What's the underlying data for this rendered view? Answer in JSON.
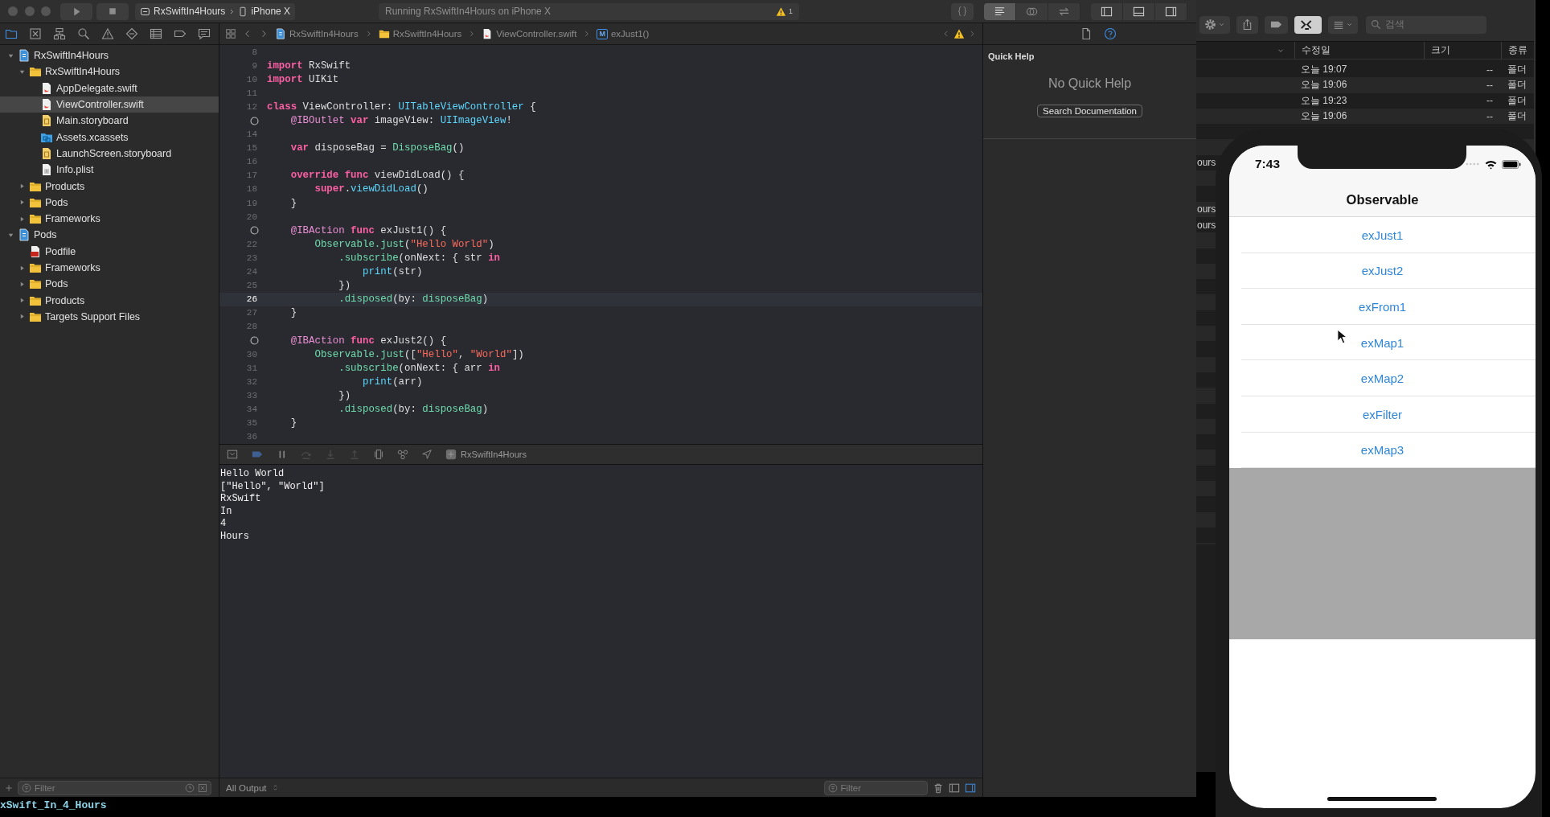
{
  "xcode": {
    "toolbar": {
      "scheme": "RxSwiftIn4Hours",
      "device": "iPhone X",
      "activity": "Running RxSwiftIn4Hours on iPhone X",
      "warning_count": "1"
    },
    "editor_modes": [
      {
        "kind": "standard",
        "selected": true
      },
      {
        "kind": "assistant",
        "selected": false
      },
      {
        "kind": "version",
        "selected": false
      }
    ],
    "panels": [
      {
        "kind": "navigator",
        "on": true
      },
      {
        "kind": "debug",
        "on": true
      },
      {
        "kind": "inspector",
        "on": true
      }
    ],
    "navigator_tabs": [
      {
        "kind": "project",
        "selected": true
      },
      {
        "kind": "source",
        "selected": false
      },
      {
        "kind": "symbol",
        "selected": false
      },
      {
        "kind": "find",
        "selected": false
      },
      {
        "kind": "issue",
        "selected": false
      },
      {
        "kind": "test",
        "selected": false
      },
      {
        "kind": "debug",
        "selected": false
      },
      {
        "kind": "breakpoint",
        "selected": false
      },
      {
        "kind": "report",
        "selected": false
      }
    ],
    "navigator": [
      {
        "name": "RxSwiftIn4Hours",
        "kind": "project",
        "expanded": true,
        "selected": false,
        "children": [
          {
            "name": "RxSwiftIn4Hours",
            "kind": "folder",
            "expanded": true,
            "selected": false,
            "children": [
              {
                "name": "AppDelegate.swift",
                "kind": "swift",
                "selected": false
              },
              {
                "name": "ViewController.swift",
                "kind": "swift",
                "selected": true
              },
              {
                "name": "Main.storyboard",
                "kind": "storyboard",
                "selected": false
              },
              {
                "name": "Assets.xcassets",
                "kind": "assets",
                "selected": false
              },
              {
                "name": "LaunchScreen.storyboard",
                "kind": "storyboard",
                "selected": false
              },
              {
                "name": "Info.plist",
                "kind": "plist",
                "selected": false
              }
            ]
          },
          {
            "name": "Products",
            "kind": "folder",
            "expanded": false,
            "selected": false
          },
          {
            "name": "Pods",
            "kind": "folder",
            "expanded": false,
            "selected": false
          },
          {
            "name": "Frameworks",
            "kind": "folder",
            "expanded": false,
            "selected": false
          }
        ]
      },
      {
        "name": "Pods",
        "kind": "project",
        "expanded": true,
        "selected": false,
        "children": [
          {
            "name": "Podfile",
            "kind": "ruby",
            "selected": false
          },
          {
            "name": "Frameworks",
            "kind": "folder",
            "expanded": false,
            "selected": false
          },
          {
            "name": "Pods",
            "kind": "folder",
            "expanded": false,
            "selected": false
          },
          {
            "name": "Products",
            "kind": "folder",
            "expanded": false,
            "selected": false
          },
          {
            "name": "Targets Support Files",
            "kind": "folder",
            "expanded": false,
            "selected": false
          }
        ]
      }
    ],
    "navigator_filter": {
      "placeholder": "Filter"
    },
    "jump_bar": [
      {
        "kind": "project",
        "text": "RxSwiftIn4Hours"
      },
      {
        "kind": "folder",
        "text": "RxSwiftIn4Hours"
      },
      {
        "kind": "swift",
        "text": "ViewController.swift"
      },
      {
        "kind": "method",
        "badge": "M",
        "text": "exJust1()"
      }
    ],
    "editor": {
      "lines": [
        {
          "kind": "numbered",
          "number": "8",
          "current": false
        },
        {
          "kind": "numbered",
          "number": "9",
          "current": false,
          "tokens": [
            {
              "kind": "keyword",
              "text": "import"
            },
            {
              "kind": "plain",
              "text": " RxSwift"
            }
          ]
        },
        {
          "kind": "numbered",
          "number": "10",
          "current": false,
          "tokens": [
            {
              "kind": "keyword",
              "text": "import"
            },
            {
              "kind": "plain",
              "text": " UIKit"
            }
          ]
        },
        {
          "kind": "numbered",
          "number": "11",
          "current": false
        },
        {
          "kind": "numbered",
          "number": "12",
          "current": false,
          "tokens": [
            {
              "kind": "keyword",
              "text": "class"
            },
            {
              "kind": "plain",
              "text": " ViewController: "
            },
            {
              "kind": "type",
              "text": "UITableViewController"
            },
            {
              "kind": "plain",
              "text": " {"
            }
          ]
        },
        {
          "kind": "connected",
          "current": false,
          "tokens": [
            {
              "kind": "attribute",
              "text": "    @IBOutlet"
            },
            {
              "kind": "keyword",
              "text": " var"
            },
            {
              "kind": "plain",
              "text": " imageView: "
            },
            {
              "kind": "type",
              "text": "UIImageView"
            },
            {
              "kind": "plain",
              "text": "!"
            }
          ]
        },
        {
          "kind": "numbered",
          "number": "14",
          "current": false
        },
        {
          "kind": "numbered",
          "number": "15",
          "current": false,
          "tokens": [
            {
              "kind": "keyword",
              "text": "    var"
            },
            {
              "kind": "plain",
              "text": " disposeBag = "
            },
            {
              "kind": "project",
              "text": "DisposeBag"
            },
            {
              "kind": "plain",
              "text": "()"
            }
          ]
        },
        {
          "kind": "numbered",
          "number": "16",
          "current": false
        },
        {
          "kind": "numbered",
          "number": "17",
          "current": false,
          "tokens": [
            {
              "kind": "keyword",
              "text": "    override"
            },
            {
              "kind": "keyword",
              "text": " func"
            },
            {
              "kind": "plain",
              "text": " viewDidLoad() {"
            }
          ]
        },
        {
          "kind": "numbered",
          "number": "18",
          "current": false,
          "tokens": [
            {
              "kind": "keyword",
              "text": "        super"
            },
            {
              "kind": "plain",
              "text": "."
            },
            {
              "kind": "type",
              "text": "viewDidLoad"
            },
            {
              "kind": "plain",
              "text": "()"
            }
          ]
        },
        {
          "kind": "numbered",
          "number": "19",
          "current": false,
          "tokens": [
            {
              "kind": "plain",
              "text": "    }"
            }
          ]
        },
        {
          "kind": "numbered",
          "number": "20",
          "current": false
        },
        {
          "kind": "connected",
          "current": false,
          "tokens": [
            {
              "kind": "attribute",
              "text": "    @IBAction"
            },
            {
              "kind": "keyword",
              "text": " func"
            },
            {
              "kind": "plain",
              "text": " exJust1() {"
            }
          ]
        },
        {
          "kind": "numbered",
          "number": "22",
          "current": false,
          "tokens": [
            {
              "kind": "project",
              "text": "        Observable.just"
            },
            {
              "kind": "plain",
              "text": "("
            },
            {
              "kind": "string",
              "text": "\"Hello World\""
            },
            {
              "kind": "plain",
              "text": ")"
            }
          ]
        },
        {
          "kind": "numbered",
          "number": "23",
          "current": false,
          "tokens": [
            {
              "kind": "project",
              "text": "            .subscribe"
            },
            {
              "kind": "plain",
              "text": "(onNext: { str "
            },
            {
              "kind": "keyword",
              "text": "in"
            }
          ]
        },
        {
          "kind": "numbered",
          "number": "24",
          "current": false,
          "tokens": [
            {
              "kind": "type",
              "text": "                print"
            },
            {
              "kind": "plain",
              "text": "(str)"
            }
          ]
        },
        {
          "kind": "numbered",
          "number": "25",
          "current": false,
          "tokens": [
            {
              "kind": "plain",
              "text": "            })"
            }
          ]
        },
        {
          "kind": "numbered",
          "number": "26",
          "current": true,
          "tokens": [
            {
              "kind": "project",
              "text": "            .disposed"
            },
            {
              "kind": "plain",
              "text": "(by: "
            },
            {
              "kind": "project",
              "text": "disposeBag"
            },
            {
              "kind": "plain",
              "text": ")"
            }
          ]
        },
        {
          "kind": "numbered",
          "number": "27",
          "current": false,
          "tokens": [
            {
              "kind": "plain",
              "text": "    }"
            }
          ]
        },
        {
          "kind": "numbered",
          "number": "28",
          "current": false
        },
        {
          "kind": "connected",
          "current": false,
          "tokens": [
            {
              "kind": "attribute",
              "text": "    @IBAction"
            },
            {
              "kind": "keyword",
              "text": " func"
            },
            {
              "kind": "plain",
              "text": " exJust2() {"
            }
          ]
        },
        {
          "kind": "numbered",
          "number": "30",
          "current": false,
          "tokens": [
            {
              "kind": "project",
              "text": "        Observable.just"
            },
            {
              "kind": "plain",
              "text": "(["
            },
            {
              "kind": "string",
              "text": "\"Hello\""
            },
            {
              "kind": "plain",
              "text": ", "
            },
            {
              "kind": "string",
              "text": "\"World\""
            },
            {
              "kind": "plain",
              "text": "])"
            }
          ]
        },
        {
          "kind": "numbered",
          "number": "31",
          "current": false,
          "tokens": [
            {
              "kind": "project",
              "text": "            .subscribe"
            },
            {
              "kind": "plain",
              "text": "(onNext: { arr "
            },
            {
              "kind": "keyword",
              "text": "in"
            }
          ]
        },
        {
          "kind": "numbered",
          "number": "32",
          "current": false,
          "tokens": [
            {
              "kind": "type",
              "text": "                print"
            },
            {
              "kind": "plain",
              "text": "(arr)"
            }
          ]
        },
        {
          "kind": "numbered",
          "number": "33",
          "current": false,
          "tokens": [
            {
              "kind": "plain",
              "text": "            })"
            }
          ]
        },
        {
          "kind": "numbered",
          "number": "34",
          "current": false,
          "tokens": [
            {
              "kind": "project",
              "text": "            .disposed"
            },
            {
              "kind": "plain",
              "text": "(by: "
            },
            {
              "kind": "project",
              "text": "disposeBag"
            },
            {
              "kind": "plain",
              "text": ")"
            }
          ]
        },
        {
          "kind": "numbered",
          "number": "35",
          "current": false,
          "tokens": [
            {
              "kind": "plain",
              "text": "    }"
            }
          ]
        },
        {
          "kind": "numbered",
          "number": "36",
          "current": false
        }
      ]
    },
    "inspector": {
      "tabs": [
        {
          "kind": "file",
          "selected": false
        },
        {
          "kind": "help",
          "selected": true
        }
      ],
      "title": "Quick Help",
      "message": "No Quick Help",
      "button": "Search Documentation"
    },
    "debug_bar": {
      "process": "RxSwiftIn4Hours"
    },
    "console": {
      "output": [
        "Hello World",
        "[\"Hello\", \"World\"]",
        "RxSwift",
        "In",
        "4",
        "Hours"
      ],
      "scope": "All Output",
      "filter": {
        "placeholder": "Filter"
      }
    }
  },
  "finder": {
    "search": {
      "placeholder": "검색"
    },
    "columns": [
      "수정일",
      "크기",
      "종류"
    ],
    "rows": [
      {
        "modified": "오늘 19:07",
        "size": "--",
        "type": "폴더"
      },
      {
        "modified": "오늘 19:06",
        "size": "--",
        "type": "폴더"
      },
      {
        "modified": "오늘 19:23",
        "size": "--",
        "type": "폴더"
      },
      {
        "modified": "오늘 19:06",
        "size": "--",
        "type": "폴더"
      }
    ],
    "name_fragments": [
      "ours",
      "ours",
      "ours"
    ]
  },
  "simulator": {
    "time": "7:43",
    "title": "Observable",
    "rows": [
      "exJust1",
      "exJust2",
      "exFrom1",
      "exMap1",
      "exMap2",
      "exFilter",
      "exMap3"
    ]
  },
  "terminal": {
    "text": "xSwift_In_4_Hours"
  }
}
